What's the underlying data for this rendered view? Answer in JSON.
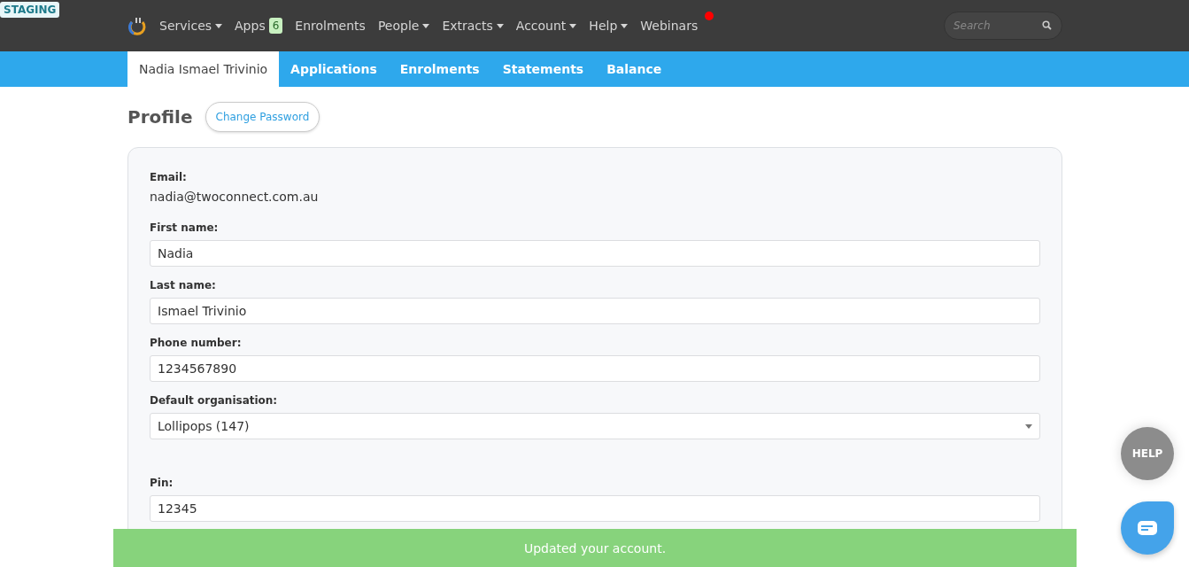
{
  "environment_badge": "STAGING",
  "nav": {
    "items": [
      {
        "label": "Services",
        "dropdown": true
      },
      {
        "label": "Apps",
        "dropdown": false,
        "badge": "6"
      },
      {
        "label": "Enrolments",
        "dropdown": false
      },
      {
        "label": "People",
        "dropdown": true
      },
      {
        "label": "Extracts",
        "dropdown": true
      },
      {
        "label": "Account",
        "dropdown": true
      },
      {
        "label": "Help",
        "dropdown": true
      },
      {
        "label": "Webinars",
        "dropdown": false,
        "notification": true
      }
    ],
    "search": {
      "placeholder": "Search"
    }
  },
  "tabs": [
    {
      "label": "Nadia Ismael Trivinio",
      "selected": true
    },
    {
      "label": "Applications",
      "selected": false
    },
    {
      "label": "Enrolments",
      "selected": false
    },
    {
      "label": "Statements",
      "selected": false
    },
    {
      "label": "Balance",
      "selected": false
    }
  ],
  "profile": {
    "title": "Profile",
    "change_password": "Change Password",
    "fields": [
      {
        "kind": "static",
        "label": "Email:",
        "value": "nadia@twoconnect.com.au"
      },
      {
        "kind": "text",
        "label": "First name:",
        "value": "Nadia"
      },
      {
        "kind": "text",
        "label": "Last name:",
        "value": "Ismael Trivinio"
      },
      {
        "kind": "text",
        "label": "Phone number:",
        "value": "1234567890"
      },
      {
        "kind": "select",
        "label": "Default organisation:",
        "value": "Lollipops (147)"
      },
      {
        "kind": "text",
        "label": "Pin:",
        "value": "12345"
      }
    ]
  },
  "help_button": "HELP",
  "toast": "Updated your account."
}
